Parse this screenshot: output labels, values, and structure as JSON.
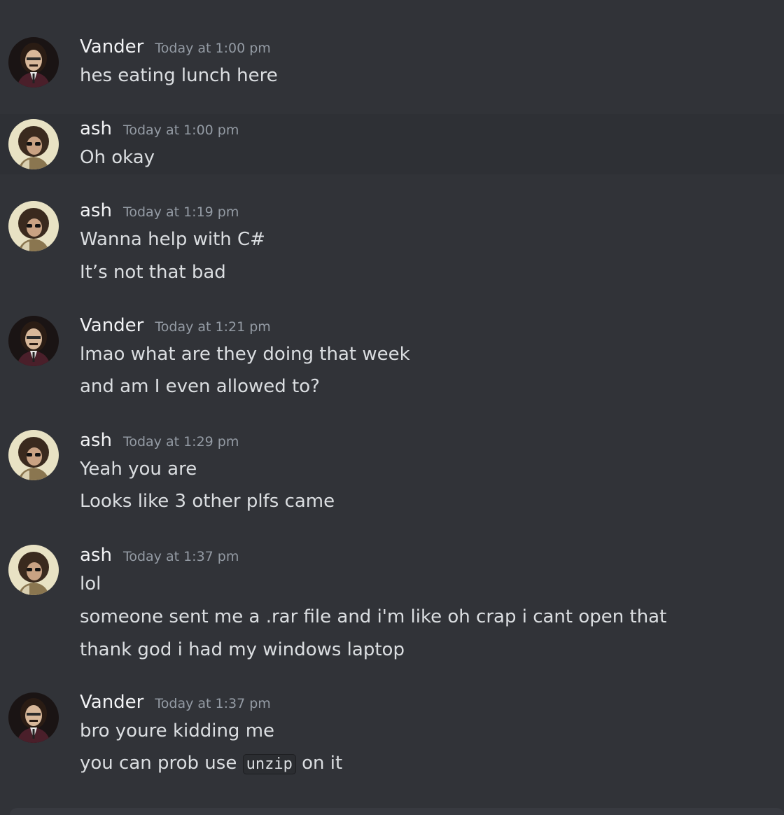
{
  "messages": [
    {
      "user": "Vander",
      "time": "Today at 1:00 pm",
      "avatar": "vander-avatar",
      "lines": [
        "hes eating lunch here"
      ]
    },
    {
      "user": "ash",
      "time": "Today at 1:00 pm",
      "avatar": "ash-avatar",
      "lines": [
        "Oh okay"
      ]
    },
    {
      "user": "ash",
      "time": "Today at 1:19 pm",
      "avatar": "ash-avatar",
      "lines": [
        "Wanna help with C#",
        "It’s not that bad"
      ]
    },
    {
      "user": "Vander",
      "time": "Today at 1:21 pm",
      "avatar": "vander-avatar",
      "lines": [
        "lmao what are they doing that week",
        "and am I even allowed to?"
      ]
    },
    {
      "user": "ash",
      "time": "Today at 1:29 pm",
      "avatar": "ash-avatar",
      "lines": [
        "Yeah you are",
        "Looks like 3 other plfs came"
      ]
    },
    {
      "user": "ash",
      "time": "Today at 1:37 pm",
      "avatar": "ash-avatar",
      "lines": [
        "lol",
        "someone sent me a .rar file and i'm like oh crap i cant open that",
        "thank god i had my windows laptop"
      ]
    },
    {
      "user": "Vander",
      "time": "Today at 1:37 pm",
      "avatar": "vander-avatar",
      "lines": [
        "bro youre kidding me"
      ],
      "last_line": {
        "before": "you can prob use",
        "code": "unzip",
        "after": "on it"
      }
    }
  ],
  "colors": {
    "background": "#313338",
    "hover_background": "#2e3035",
    "username": "#f2f3f5",
    "timestamp": "#949ba4",
    "text": "#dbdee1"
  }
}
